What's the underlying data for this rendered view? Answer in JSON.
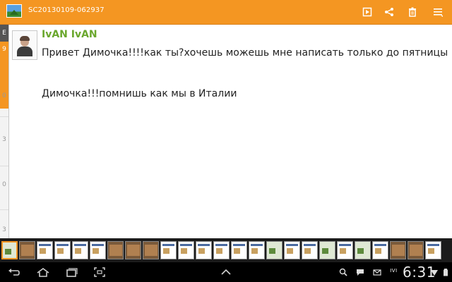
{
  "app": {
    "title": "SC20130109-062937"
  },
  "toolbar": {
    "icons": [
      "slideshow-icon",
      "share-icon",
      "delete-icon",
      "menu-icon"
    ]
  },
  "left_strip": {
    "top_letter": "E",
    "highlight_number": "9",
    "numbers": [
      "0",
      "3",
      "0",
      "3"
    ]
  },
  "message": {
    "sender": "IvAN IvAN",
    "line1": "Привет Димочка!!!!как ты?хочешь можешь мне написать только до пятницы",
    "line2": "Димочка!!!помнишь как мы в Италии"
  },
  "status_bar": {
    "network_label": "ıvı",
    "time": "6:31"
  },
  "colors": {
    "accent": "#f49622",
    "sender_name": "#6aa72d"
  }
}
